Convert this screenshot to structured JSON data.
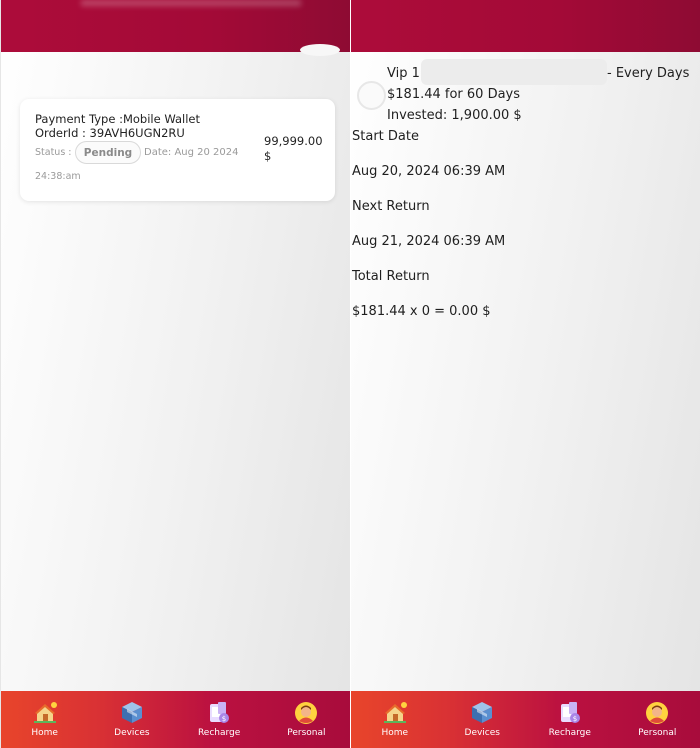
{
  "left": {
    "card": {
      "payment_type": "Payment Type :Mobile Wallet",
      "order_id": "OrderId : 39AVH6UGN2RU",
      "status_label": "Status :",
      "status_value": "Pending",
      "date": "Date: Aug 20 2024",
      "time": "24:38:am",
      "amount_value": "99,999.00",
      "amount_currency": "$"
    }
  },
  "right": {
    "plan_name": "Vip 1",
    "frequency": "- Every Days",
    "per_return": "$181.44 for 60 Days",
    "invested": "Invested: 1,900.00 $",
    "start_label": "Start Date",
    "start_value": "Aug 20, 2024 06:39 AM",
    "next_label": "Next Return",
    "next_value": "Aug 21, 2024 06:39 AM",
    "total_label": "Total Return",
    "total_value": "$181.44 x 0 = 0.00 $"
  },
  "nav": [
    {
      "label": "Home",
      "icon": "home-icon"
    },
    {
      "label": "Devices",
      "icon": "devices-icon"
    },
    {
      "label": "Recharge",
      "icon": "recharge-icon"
    },
    {
      "label": "Personal",
      "icon": "personal-icon"
    }
  ],
  "colors": {
    "header": "#a30a37",
    "nav_start": "#e8452b",
    "nav_end": "#a80c3c"
  }
}
